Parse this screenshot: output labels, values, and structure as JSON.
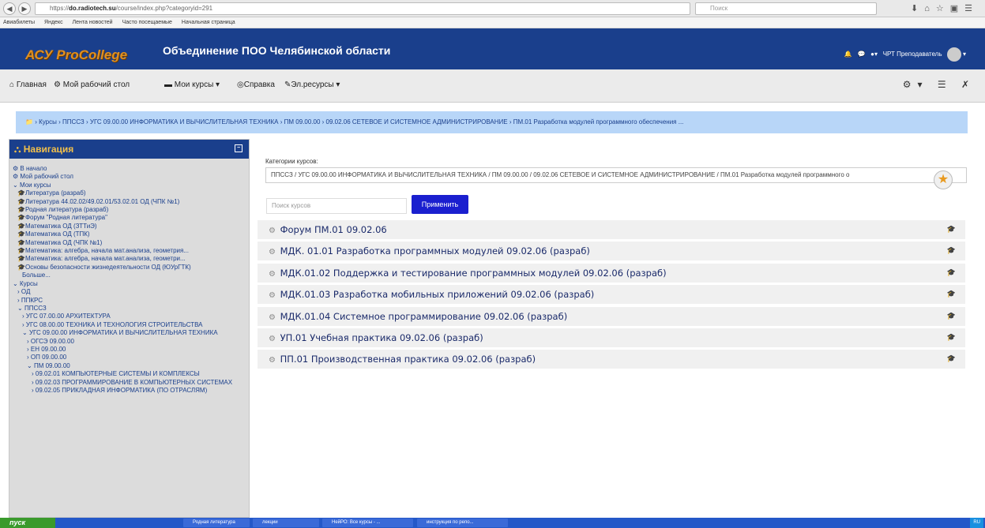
{
  "browser": {
    "url_prefix": "https://",
    "url_host": "do.radiotech.su",
    "url_path": "/course/index.php?categoryid=291",
    "search_placeholder": "Поиск"
  },
  "bookmarks": [
    "Авиабилеты",
    "Яндекс",
    "Лента новостей",
    "Часто посещаемые",
    "Начальная страница"
  ],
  "header": {
    "logo": "АСУ ProCollege",
    "title": "Объединение ПОО Челябинской области",
    "user": "ЧРТ Преподаватель"
  },
  "menu": {
    "home": "Главная",
    "dashboard": "Мой рабочий стол",
    "mycourses": "Мои курсы",
    "help": "Справка",
    "eresources": "Эл.ресурсы"
  },
  "breadcrumb": [
    "Курсы",
    "ППССЗ",
    "УГС 09.00.00 ИНФОРМАТИКА И ВЫЧИСЛИТЕЛЬНАЯ ТЕХНИКА",
    "ПМ 09.00.00",
    "09.02.06 СЕТЕВОЕ И СИСТЕМНОЕ АДМИНИСТРИРОВАНИЕ",
    "ПМ.01 Разработка модулей программного обеспечения ..."
  ],
  "navigation": {
    "title": "Навигация",
    "items": [
      "В начало",
      "Мой рабочий стол",
      "Мои курсы",
      "Литература (разраб)",
      "Литература 44.02.02/49.02.01/53.02.01 ОД (ЧПК №1)",
      "Родная литература (разраб)",
      "Форум \"Родная литература\"",
      "Математика ОД (ЗТТиЭ)",
      "Математика ОД (ТПК)",
      "Математика ОД (ЧПК №1)",
      "Математика: алгебра, начала мат.анализа, геометрия...",
      "Математика: алгебра, начала мат.анализа, геометри...",
      "Основы безопасности жизнедеятельности ОД (ЮУрГТК)",
      "Больше...",
      "Курсы",
      "ОД",
      "ППКРС",
      "ППССЗ",
      "УГС 07.00.00 АРХИТЕКТУРА",
      "УГС 08.00.00 ТЕХНИКА И ТЕХНОЛОГИЯ СТРОИТЕЛЬСТВА",
      "УГС 09.00.00 ИНФОРМАТИКА И ВЫЧИСЛИТЕЛЬНАЯ ТЕХНИКА",
      "ОГСЭ 09.00.00",
      "ЕН 09.00.00",
      "ОП 09.00.00",
      "ПМ 09.00.00",
      "09.02.01 КОМПЬЮТЕРНЫЕ СИСТЕМЫ И КОМПЛЕКСЫ",
      "09.02.03 ПРОГРАММИРОВАНИЕ В КОМПЬЮТЕРНЫХ СИСТЕМАХ",
      "09.02.05 ПРИКЛАДНАЯ ИНФОРМАТИКА (ПО ОТРАСЛЯМ)"
    ]
  },
  "main": {
    "category_label": "Категории курсов:",
    "category_value": "ППССЗ / УГС 09.00.00 ИНФОРМАТИКА И ВЫЧИСЛИТЕЛЬНАЯ ТЕХНИКА / ПМ 09.00.00 / 09.02.06 СЕТЕВОЕ И СИСТЕМНОЕ АДМИНИСТРИРОВАНИЕ / ПМ.01 Разработка модулей программного о",
    "search_placeholder": "Поиск курсов",
    "apply_label": "Применить",
    "courses": [
      "Форум ПМ.01 09.02.06",
      "МДК. 01.01 Разработка программных модулей 09.02.06 (разраб)",
      "МДК.01.02 Поддержка и тестирование программных модулей 09.02.06 (разраб)",
      "МДК.01.03 Разработка мобильных приложений 09.02.06 (разраб)",
      "МДК.01.04 Системное программирование 09.02.06 (разраб)",
      "УП.01 Учебная практика 09.02.06 (разраб)",
      "ПП.01 Производственная практика 09.02.06 (разраб)"
    ]
  },
  "taskbar": {
    "start": "пуск",
    "tasks": [
      "Родная литература",
      "лекции",
      "НейРО: Все курсы - ...",
      "инструкция по репо..."
    ],
    "tray": "RU"
  }
}
